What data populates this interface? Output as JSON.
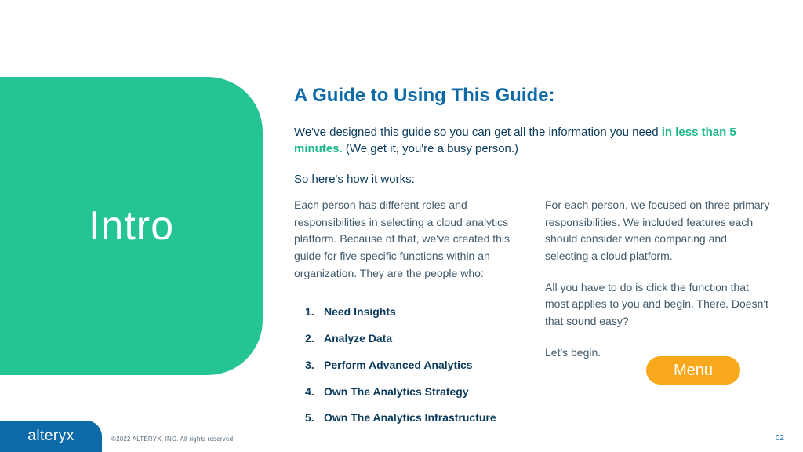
{
  "panel": {
    "label": "Intro"
  },
  "content": {
    "title": "A Guide to Using This Guide:",
    "lede_pre": "We've designed this guide so you can get all the information you need ",
    "lede_highlight": "in less than 5 minutes.",
    "lede_post": " (We get it, you're a busy person.)",
    "how_label": "So here's how it works:",
    "col1_para": "Each person has different roles and responsibilities in selecting a cloud analytics platform. Because of that, we've created this guide for five specific functions within an organization. They are the people who:",
    "functions": [
      "Need Insights",
      "Analyze Data",
      "Perform Advanced Analytics",
      "Own The Analytics Strategy",
      "Own The Analytics Infrastructure"
    ],
    "col2_p1": "For each person, we focused on three primary responsibilities. We included features each should consider when comparing and selecting a cloud platform.",
    "col2_p2": "All you have to do is click the function that most applies to you and begin. There. Doesn't that sound easy?",
    "col2_p3": "Let's begin."
  },
  "menu": {
    "label": "Menu"
  },
  "footer": {
    "brand": "alteryx",
    "copyright": "©2022 ALTERYX, INC. All rights reserved.",
    "page": "02"
  }
}
